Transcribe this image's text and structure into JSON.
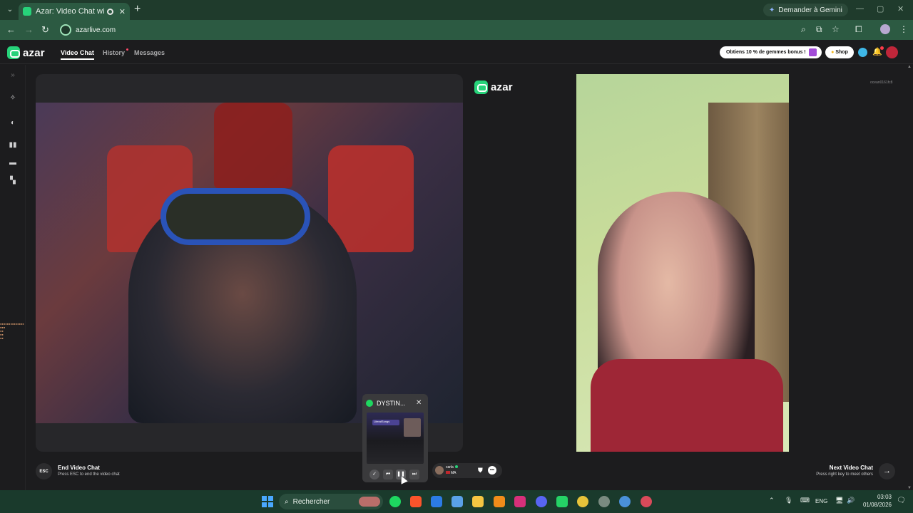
{
  "browser": {
    "tab_title": "Azar: Video Chat with New",
    "new_tab_label": "+",
    "url": "azarlive.com",
    "gemini_label": "Demander à Gemini"
  },
  "app": {
    "logo_text": "azar",
    "nav": {
      "video_chat": "Video Chat",
      "history": "History",
      "messages": "Messages"
    },
    "promo_text": "Obtiens 10 % de gemmes bonus !",
    "shop_label": "Shop",
    "watermark": "ocean0161fc8"
  },
  "call": {
    "mid_logo_text": "azar",
    "end": {
      "key_label": "ESC",
      "title": "End Video Chat",
      "subtitle": "Press ESC to end the video chat"
    },
    "next": {
      "title": "Next Video Chat",
      "subtitle": "Press right key to meet others",
      "arrow": "→"
    },
    "peer": {
      "name": "carla",
      "country": "MA"
    }
  },
  "spotify": {
    "title": "DYSTIN...",
    "close": "✕",
    "thumb_header": "LiteralSongs"
  },
  "overlay_text": "▪▪▪▪▪▪▪▪▪▪▪▪▪▪\n▪▪▪\n▪▪\n▪▪\n▪▪",
  "taskbar": {
    "search_placeholder": "Rechercher",
    "language": "ENG",
    "time": "03:03",
    "date": "01/08/2026"
  },
  "colors": {
    "brand_green": "#27d37a",
    "chrome_green": "#2c5a42",
    "app_bg": "#1c1c1e"
  },
  "icons": {
    "tab_dropdown": "chevron-down-icon",
    "back": "arrow-left-icon",
    "forward": "arrow-right-icon",
    "reload": "reload-icon",
    "zoom": "zoom-icon",
    "install": "install-app-icon",
    "bookmark": "star-icon",
    "extensions": "puzzle-icon",
    "menu": "kebab-menu-icon"
  }
}
